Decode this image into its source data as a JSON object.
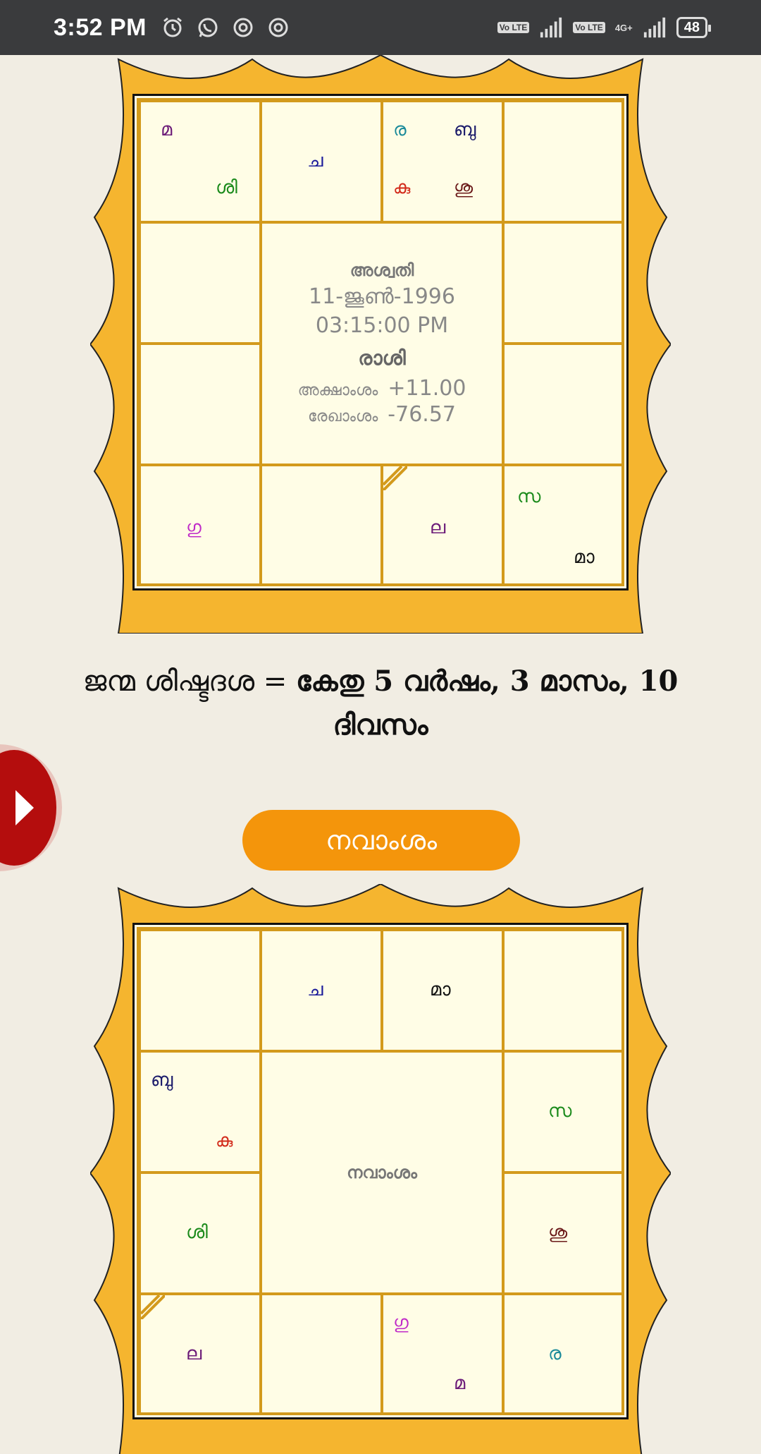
{
  "status": {
    "time": "3:52 PM",
    "battery": "48",
    "network": "4G+",
    "lte1": "Vo LTE",
    "lte2": "Vo LTE"
  },
  "rasi_chart": {
    "center": {
      "nakshatra": "അശ്വതി",
      "date": "11-ജൂൺ-1996",
      "time": "03:15:00 PM",
      "title": "രാശി",
      "lat_label": "അക്ഷാംശം",
      "lat_value": "+11.00",
      "lon_label": "രേഖാംശം",
      "lon_value": "-76.57"
    },
    "planets": {
      "c0_a": "മ",
      "c0_b": "ശി",
      "c1_a": "ച",
      "c2_a": "ര",
      "c2_b": "ബു",
      "c2_c": "കു",
      "c2_d": "ശു",
      "c12_a": "ഗു",
      "c14_a": "ല",
      "c15_a": "സ",
      "c15_b": "മാ"
    }
  },
  "dasha": {
    "prefix": "ജന്മ ശിഷ്ടദശ = ",
    "value": "കേതു 5 വർഷം, 3 മാസം, 10 ദിവസം"
  },
  "navamsa_button": {
    "label": "നവാംശം"
  },
  "navamsa_chart": {
    "center_title": "നവാംശം",
    "planets": {
      "c1_a": "ച",
      "c2_a": "മാ",
      "c4_a": "ബു",
      "c4_b": "കു",
      "c7_a": "സ",
      "c8_a": "ശി",
      "c11_a": "ശു",
      "c12_a": "ല",
      "c14_a": "ഗു",
      "c14_b": "മ",
      "c15_a": "ര"
    }
  },
  "colors": {
    "accent_orange": "#f4950b",
    "frame_gold": "#f5b52f",
    "grid_line": "#d39a1c",
    "chart_bg": "#fffde6",
    "side_button_red": "#b40d0d"
  }
}
